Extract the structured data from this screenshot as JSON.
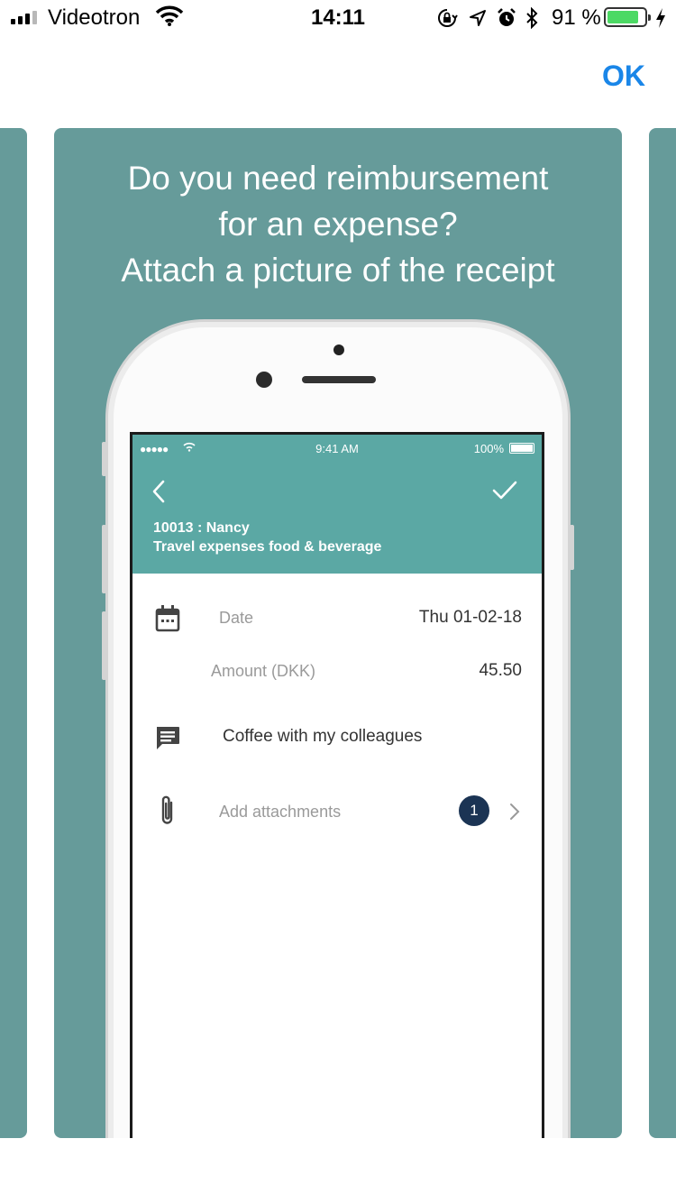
{
  "status_bar": {
    "carrier": "Videotron",
    "time": "14:11",
    "battery_pct": "91 %",
    "battery_level": 0.91
  },
  "nav": {
    "ok_label": "OK"
  },
  "card": {
    "headline_lines": [
      "Do you need reimbursement",
      "for an expense?",
      "Attach a picture of the receipt"
    ]
  },
  "mock_phone": {
    "status": {
      "time": "9:41 AM",
      "battery": "100%"
    },
    "header": {
      "line1": "10013 : Nancy",
      "line2": "Travel expenses food & beverage"
    },
    "form": {
      "date_label": "Date",
      "date_value": "Thu 01-02-18",
      "amount_label": "Amount (DKK)",
      "amount_value": "45.50",
      "comment": "Coffee with my colleagues",
      "attachments_label": "Add attachments",
      "attachments_count": "1"
    }
  },
  "colors": {
    "card_bg": "#669b9a",
    "app_header": "#5ba8a4",
    "ok_blue": "#1a86e8",
    "badge": "#1b3454",
    "battery_green": "#4cd964"
  }
}
